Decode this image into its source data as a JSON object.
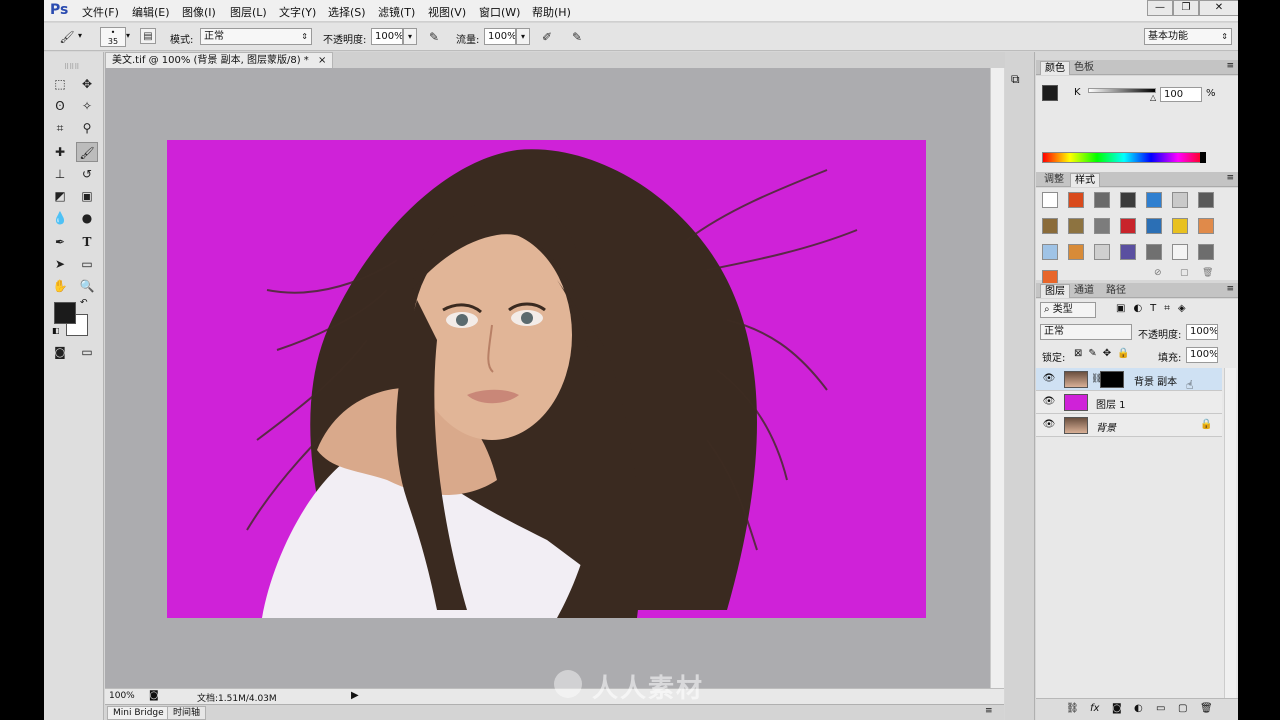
{
  "app": {
    "logo": "Ps",
    "menu": [
      "文件(F)",
      "编辑(E)",
      "图像(I)",
      "图层(L)",
      "文字(Y)",
      "选择(S)",
      "滤镜(T)",
      "视图(V)",
      "窗口(W)",
      "帮助(H)"
    ],
    "window_buttons": {
      "minimize": "—",
      "restore": "❐",
      "close": "✕"
    }
  },
  "options": {
    "brush_size": "35",
    "mode_label": "模式:",
    "mode_value": "正常",
    "opacity_label": "不透明度:",
    "opacity_value": "100%",
    "flow_label": "流量:",
    "flow_value": "100%",
    "workspace": "基本功能"
  },
  "document": {
    "tab_title": "美文.tif @ 100% (背景 副本, 图层蒙版/8) *",
    "tab_close": "×",
    "canvas_color": "#cf22d8"
  },
  "status": {
    "zoom": "100%",
    "doc_info": "文档:1.51M/4.03M"
  },
  "bottom_tabs": [
    "Mini Bridge",
    "时间轴"
  ],
  "color_panel": {
    "tabs": [
      "颜色",
      "色板"
    ],
    "channel": "K",
    "value": "100",
    "unit": "%"
  },
  "styles_panel": {
    "tabs": [
      "调整",
      "样式"
    ],
    "swatches": [
      "#ffffff",
      "#d94a1c",
      "#6a6a6a",
      "#3b3b3b",
      "#2f7fd0",
      "#c9c9c9",
      "#5a5a5a",
      "#8a6b3a",
      "#8d7340",
      "#7c7c7c",
      "#c8242b",
      "#2b6fb5",
      "#e8c120",
      "#e08a4a",
      "#9fc3e6",
      "#d88b38",
      "#cfcfcf",
      "#5a4fa0",
      "#707070",
      "#f4f4f4",
      "#6d6d6d",
      "#e8662a"
    ]
  },
  "layers_panel": {
    "tabs": [
      "图层",
      "通道",
      "路径"
    ],
    "filter": "类型",
    "blend_mode": "正常",
    "opacity_label": "不透明度:",
    "opacity_value": "100%",
    "lock_label": "锁定:",
    "fill_label": "填充:",
    "fill_value": "100%",
    "layers": [
      {
        "name": "背景 副本",
        "selected": true
      },
      {
        "name": "图层 1",
        "selected": false
      },
      {
        "name": "背景",
        "selected": false
      }
    ],
    "bottom_icons": [
      "link-icon",
      "fx-icon",
      "mask-icon",
      "adjustment-icon",
      "folder-icon",
      "new-layer-icon",
      "trash-icon"
    ]
  },
  "watermark": "人人素材"
}
